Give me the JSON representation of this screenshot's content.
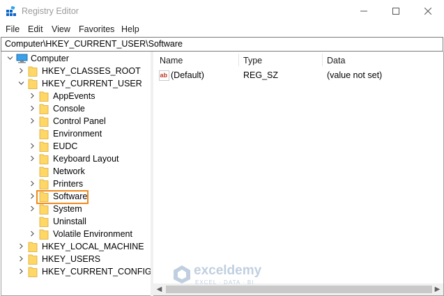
{
  "window": {
    "title": "Registry Editor"
  },
  "menu": [
    "File",
    "Edit",
    "View",
    "Favorites",
    "Help"
  ],
  "address": "Computer\\HKEY_CURRENT_USER\\Software",
  "tree": {
    "root": "Computer",
    "hives_top": [
      "HKEY_CLASSES_ROOT",
      "HKEY_CURRENT_USER"
    ],
    "current_user_children": [
      "AppEvents",
      "Console",
      "Control Panel",
      "Environment",
      "EUDC",
      "Keyboard Layout",
      "Network",
      "Printers",
      "Software",
      "System",
      "Uninstall",
      "Volatile Environment"
    ],
    "hives_bottom": [
      "HKEY_LOCAL_MACHINE",
      "HKEY_USERS",
      "HKEY_CURRENT_CONFIG"
    ],
    "selected": "Software"
  },
  "list": {
    "columns": [
      "Name",
      "Type",
      "Data"
    ],
    "rows": [
      {
        "name": "(Default)",
        "type": "REG_SZ",
        "data": "(value not set)",
        "icon": "string-value-icon"
      }
    ]
  },
  "watermark": {
    "name": "exceldemy",
    "sub": "EXCEL · DATA · BI"
  },
  "colors": {
    "selection_outline": "#f08a1c",
    "folder": "#ffd767",
    "accent": "#0078d7"
  }
}
